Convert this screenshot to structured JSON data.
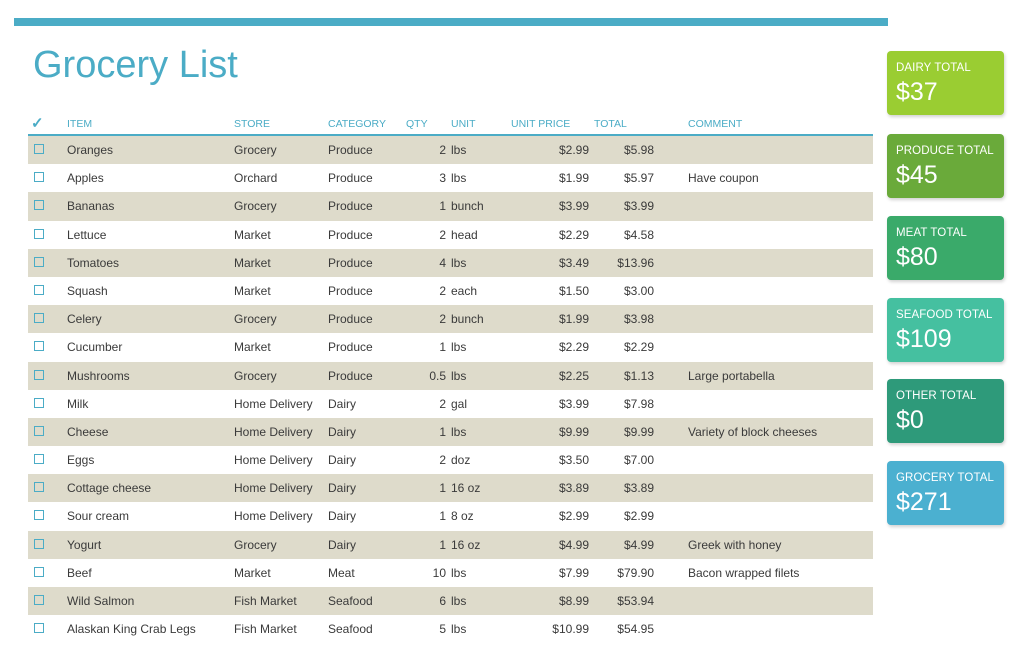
{
  "title": "Grocery List",
  "columns": {
    "check": "✓",
    "item": "ITEM",
    "store": "STORE",
    "category": "CATEGORY",
    "qty": "QTY",
    "unit": "UNIT",
    "unit_price": "UNIT PRICE",
    "total": "TOTAL",
    "comment": "COMMENT"
  },
  "rows": [
    {
      "item": "Oranges",
      "store": "Grocery",
      "category": "Produce",
      "qty": "2",
      "unit": "lbs",
      "unit_price": "$2.99",
      "total": "$5.98",
      "comment": ""
    },
    {
      "item": "Apples",
      "store": "Orchard",
      "category": "Produce",
      "qty": "3",
      "unit": "lbs",
      "unit_price": "$1.99",
      "total": "$5.97",
      "comment": "Have coupon"
    },
    {
      "item": "Bananas",
      "store": "Grocery",
      "category": "Produce",
      "qty": "1",
      "unit": "bunch",
      "unit_price": "$3.99",
      "total": "$3.99",
      "comment": ""
    },
    {
      "item": "Lettuce",
      "store": "Market",
      "category": "Produce",
      "qty": "2",
      "unit": "head",
      "unit_price": "$2.29",
      "total": "$4.58",
      "comment": ""
    },
    {
      "item": "Tomatoes",
      "store": "Market",
      "category": "Produce",
      "qty": "4",
      "unit": "lbs",
      "unit_price": "$3.49",
      "total": "$13.96",
      "comment": ""
    },
    {
      "item": "Squash",
      "store": "Market",
      "category": "Produce",
      "qty": "2",
      "unit": "each",
      "unit_price": "$1.50",
      "total": "$3.00",
      "comment": ""
    },
    {
      "item": "Celery",
      "store": "Grocery",
      "category": "Produce",
      "qty": "2",
      "unit": "bunch",
      "unit_price": "$1.99",
      "total": "$3.98",
      "comment": ""
    },
    {
      "item": "Cucumber",
      "store": "Market",
      "category": "Produce",
      "qty": "1",
      "unit": "lbs",
      "unit_price": "$2.29",
      "total": "$2.29",
      "comment": ""
    },
    {
      "item": "Mushrooms",
      "store": "Grocery",
      "category": "Produce",
      "qty": "0.5",
      "unit": "lbs",
      "unit_price": "$2.25",
      "total": "$1.13",
      "comment": "Large portabella"
    },
    {
      "item": "Milk",
      "store": "Home Delivery",
      "category": "Dairy",
      "qty": "2",
      "unit": "gal",
      "unit_price": "$3.99",
      "total": "$7.98",
      "comment": ""
    },
    {
      "item": "Cheese",
      "store": "Home Delivery",
      "category": "Dairy",
      "qty": "1",
      "unit": "lbs",
      "unit_price": "$9.99",
      "total": "$9.99",
      "comment": "Variety of block cheeses"
    },
    {
      "item": "Eggs",
      "store": "Home Delivery",
      "category": "Dairy",
      "qty": "2",
      "unit": "doz",
      "unit_price": "$3.50",
      "total": "$7.00",
      "comment": ""
    },
    {
      "item": "Cottage cheese",
      "store": "Home Delivery",
      "category": "Dairy",
      "qty": "1",
      "unit": "16 oz",
      "unit_price": "$3.89",
      "total": "$3.89",
      "comment": ""
    },
    {
      "item": "Sour cream",
      "store": "Home Delivery",
      "category": "Dairy",
      "qty": "1",
      "unit": "8 oz",
      "unit_price": "$2.99",
      "total": "$2.99",
      "comment": ""
    },
    {
      "item": "Yogurt",
      "store": "Grocery",
      "category": "Dairy",
      "qty": "1",
      "unit": "16 oz",
      "unit_price": "$4.99",
      "total": "$4.99",
      "comment": "Greek with honey"
    },
    {
      "item": "Beef",
      "store": "Market",
      "category": "Meat",
      "qty": "10",
      "unit": "lbs",
      "unit_price": "$7.99",
      "total": "$79.90",
      "comment": "Bacon wrapped filets"
    },
    {
      "item": "Wild Salmon",
      "store": "Fish Market",
      "category": "Seafood",
      "qty": "6",
      "unit": "lbs",
      "unit_price": "$8.99",
      "total": "$53.94",
      "comment": ""
    },
    {
      "item": "Alaskan King Crab Legs",
      "store": "Fish Market",
      "category": "Seafood",
      "qty": "5",
      "unit": "lbs",
      "unit_price": "$10.99",
      "total": "$54.95",
      "comment": ""
    }
  ],
  "totals": [
    {
      "label": "DAIRY TOTAL",
      "value": "$37",
      "color": "#9acd32"
    },
    {
      "label": "PRODUCE TOTAL",
      "value": "$45",
      "color": "#6aaa3a"
    },
    {
      "label": "MEAT TOTAL",
      "value": "$80",
      "color": "#3aaa6a"
    },
    {
      "label": "SEAFOOD TOTAL",
      "value": "$109",
      "color": "#45c0a0"
    },
    {
      "label": "OTHER TOTAL",
      "value": "$0",
      "color": "#2e9a7a"
    },
    {
      "label": "GROCERY TOTAL",
      "value": "$271",
      "color": "#4bb0d0"
    }
  ],
  "colors": {
    "accent": "#4bacc6",
    "alt_row": "#dedbcb"
  }
}
